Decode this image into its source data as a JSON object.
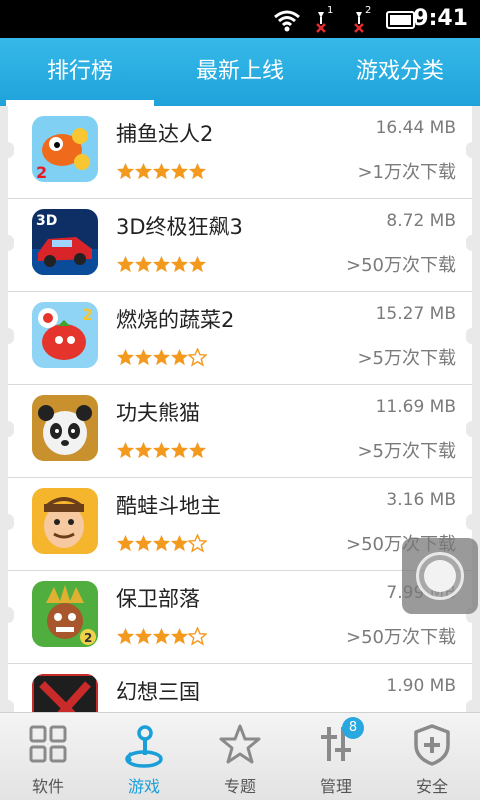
{
  "status_bar": {
    "time": "9:41",
    "sim1": "1",
    "sim2": "2"
  },
  "tabs": [
    {
      "label": "排行榜"
    },
    {
      "label": "最新上线"
    },
    {
      "label": "游戏分类"
    }
  ],
  "apps": [
    {
      "name": "捕鱼达人2",
      "size": "16.44 MB",
      "downloads": ">1万次下载",
      "rating": 5,
      "icon": "fish-game-icon"
    },
    {
      "name": "3D终极狂飙3",
      "size": "8.72 MB",
      "downloads": ">50万次下载",
      "rating": 5,
      "icon": "racing-car-icon"
    },
    {
      "name": "燃烧的蔬菜2",
      "size": "15.27 MB",
      "downloads": ">5万次下载",
      "rating": 4,
      "icon": "tomato-game-icon"
    },
    {
      "name": "功夫熊猫",
      "size": "11.69 MB",
      "downloads": ">5万次下载",
      "rating": 5,
      "icon": "panda-game-icon"
    },
    {
      "name": "酷蛙斗地主",
      "size": "3.16 MB",
      "downloads": ">50万次下载",
      "rating": 4,
      "icon": "card-game-icon"
    },
    {
      "name": "保卫部落",
      "size": "7.99 MB",
      "downloads": ">50万次下载",
      "rating": 4,
      "icon": "tribe-defense-icon"
    },
    {
      "name": "幻想三国",
      "size": "1.90 MB",
      "downloads": "",
      "rating": 0,
      "icon": "three-kingdoms-icon"
    }
  ],
  "bottom_nav": [
    {
      "label": "软件",
      "icon": "grid-icon"
    },
    {
      "label": "游戏",
      "icon": "joystick-icon"
    },
    {
      "label": "专题",
      "icon": "star-icon"
    },
    {
      "label": "管理",
      "icon": "manage-icon",
      "badge": "8"
    },
    {
      "label": "安全",
      "icon": "shield-plus-icon"
    }
  ],
  "colors": {
    "accent": "#1fa2da",
    "star": "#f39a1e"
  }
}
